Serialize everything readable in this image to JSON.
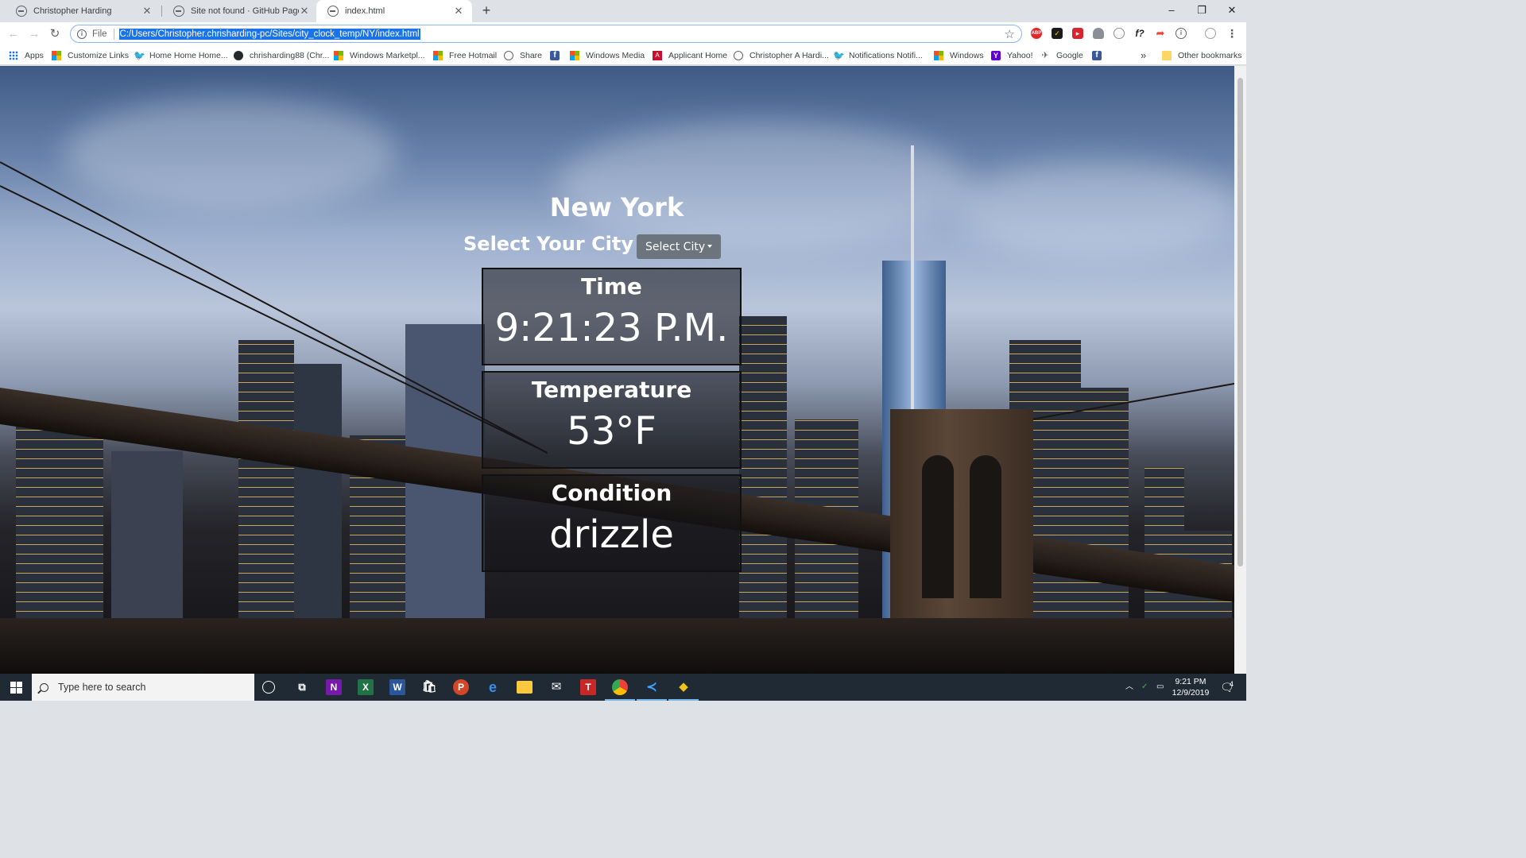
{
  "browser": {
    "tabs": [
      {
        "title": "Christopher Harding",
        "active": false
      },
      {
        "title": "Site not found · GitHub Pages",
        "active": false
      },
      {
        "title": "index.html",
        "active": true
      }
    ],
    "new_tab_label": "+",
    "window_controls": {
      "minimize": "–",
      "restore": "❐",
      "close": "✕"
    },
    "nav": {
      "back": "←",
      "forward": "→",
      "reload": "↻"
    },
    "address": {
      "scheme_label": "File",
      "url": "C:/Users/Christopher.chrisharding-pc/Sites/city_clock_temp/NY/index.html"
    },
    "extension_icons": [
      "abp-icon",
      "norton-icon",
      "screen-recorder-icon",
      "cloud-icon",
      "headphones-icon",
      "font-finder-icon",
      "share-arrow-icon",
      "info-circle-icon",
      "profile-icon"
    ],
    "menu_icon": "⋮",
    "bookmarks": [
      {
        "label": "Apps",
        "icon": "apps-icon"
      },
      {
        "label": "Customize Links",
        "icon": "windows-icon"
      },
      {
        "label": "Home Home Home...",
        "icon": "twitter-icon"
      },
      {
        "label": "chrisharding88 (Chr...",
        "icon": "github-icon"
      },
      {
        "label": "Windows Marketpl...",
        "icon": "windows-icon"
      },
      {
        "label": "Free Hotmail",
        "icon": "windows-icon"
      },
      {
        "label": "Share",
        "icon": "globe-icon"
      },
      {
        "label": "",
        "icon": "facebook-icon"
      },
      {
        "label": "Windows Media",
        "icon": "windows-icon"
      },
      {
        "label": "Applicant Home",
        "icon": "applicant-icon"
      },
      {
        "label": "Christopher A Hardi...",
        "icon": "globe-icon"
      },
      {
        "label": "Notifications Notifi...",
        "icon": "twitter-icon"
      },
      {
        "label": "Windows",
        "icon": "windows-icon"
      },
      {
        "label": "Yahoo!",
        "icon": "yahoo-icon"
      },
      {
        "label": "Google",
        "icon": "google-icon"
      },
      {
        "label": "",
        "icon": "facebook-icon"
      }
    ],
    "bookmarks_overflow": "»",
    "other_bookmarks": "Other bookmarks"
  },
  "app": {
    "city": "New York",
    "select_label": "Select Your City",
    "select_button": "Select City",
    "cards": [
      {
        "label": "Time",
        "value": "9:21:23 P.M."
      },
      {
        "label": "Temperature",
        "value": "53°F"
      },
      {
        "label": "Condition",
        "value": "drizzle"
      }
    ]
  },
  "taskbar": {
    "search_placeholder": "Type here to search",
    "time": "9:21 PM",
    "date": "12/9/2019",
    "notification_count": "4"
  },
  "colors": {
    "address_highlight": "#1a73e8",
    "select_button": "#6c757d",
    "taskbar": "#1f2a34"
  }
}
